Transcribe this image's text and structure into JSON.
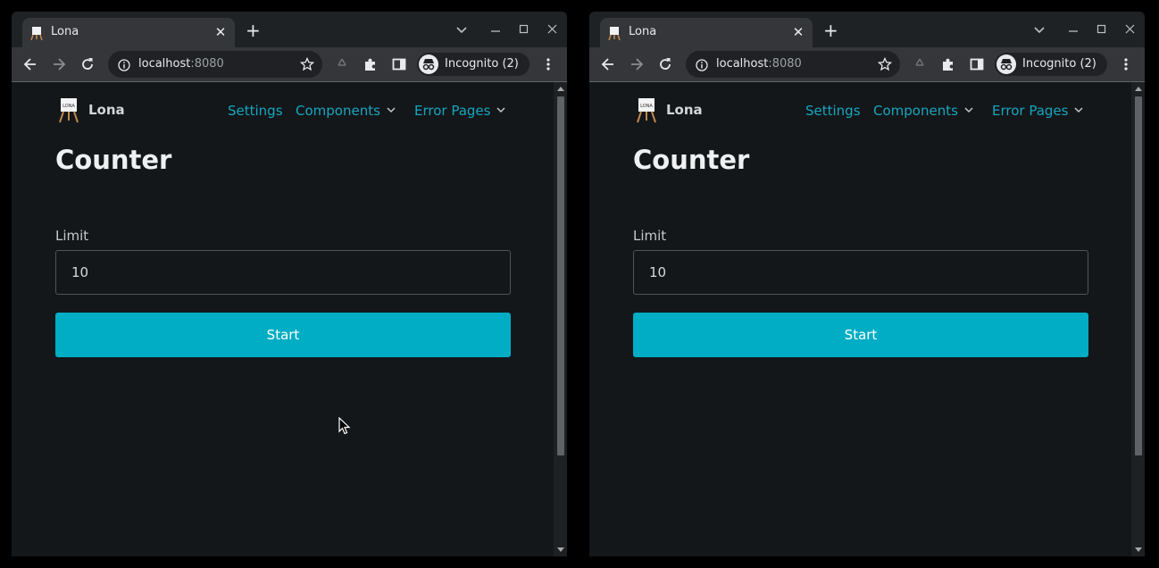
{
  "windows": [
    {
      "tab": {
        "title": "Lona"
      },
      "address": {
        "host": "localhost",
        "port": ":8080"
      },
      "profile": {
        "label": "Incognito (2)"
      },
      "page": {
        "brand": "Lona",
        "nav": {
          "settings": "Settings",
          "components": "Components",
          "error_pages": "Error Pages"
        },
        "title": "Counter",
        "limit_label": "Limit",
        "limit_value": "10",
        "start_label": "Start"
      }
    },
    {
      "tab": {
        "title": "Lona"
      },
      "address": {
        "host": "localhost",
        "port": ":8080"
      },
      "profile": {
        "label": "Incognito (2)"
      },
      "page": {
        "brand": "Lona",
        "nav": {
          "settings": "Settings",
          "components": "Components",
          "error_pages": "Error Pages"
        },
        "title": "Counter",
        "limit_label": "Limit",
        "limit_value": "10",
        "start_label": "Start"
      }
    }
  ],
  "icons": {
    "favicon": "lona-easel-icon",
    "tab_close": "close-icon",
    "new_tab": "plus-icon",
    "tab_search": "chevron-down-icon",
    "minimize": "minimize-icon",
    "maximize": "maximize-icon",
    "close_window": "close-icon",
    "back": "arrow-left-icon",
    "forward": "arrow-right-icon",
    "reload": "reload-icon",
    "site_info": "info-icon",
    "bookmark": "star-icon",
    "recycle": "recycle-icon",
    "extensions": "puzzle-icon",
    "side_panel": "side-panel-icon",
    "incognito": "incognito-icon",
    "menu": "kebab-menu-icon"
  },
  "colors": {
    "page_background": "#13171a",
    "accent_link": "#17a6bf",
    "button_primary": "#00adc4",
    "chrome_tab": "#35363a",
    "chrome_frame": "#1f2225"
  }
}
